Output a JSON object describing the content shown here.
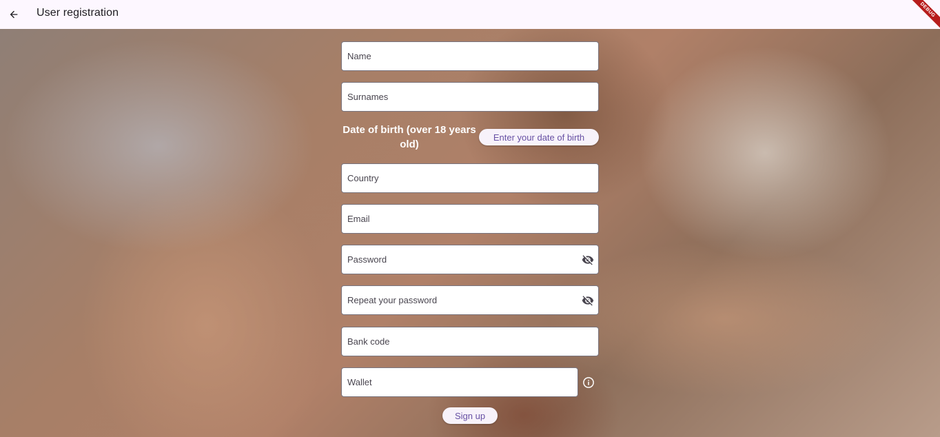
{
  "appbar": {
    "title": "User registration",
    "debug_label": "DEBUG"
  },
  "form": {
    "name_placeholder": "Name",
    "surnames_placeholder": "Surnames",
    "dob_label": "Date of birth (over 18 years old)",
    "dob_button": "Enter your date of birth",
    "country_placeholder": "Country",
    "email_placeholder": "Email",
    "password_placeholder": "Password",
    "repeat_password_placeholder": "Repeat your password",
    "bank_code_placeholder": "Bank code",
    "wallet_placeholder": "Wallet",
    "signup_label": "Sign up"
  },
  "colors": {
    "accent": "#6750a4",
    "appbar_bg": "#fdf7ff",
    "debug": "#b71c1c"
  },
  "icons": [
    "back-arrow-icon",
    "visibility-off-icon",
    "info-icon"
  ]
}
